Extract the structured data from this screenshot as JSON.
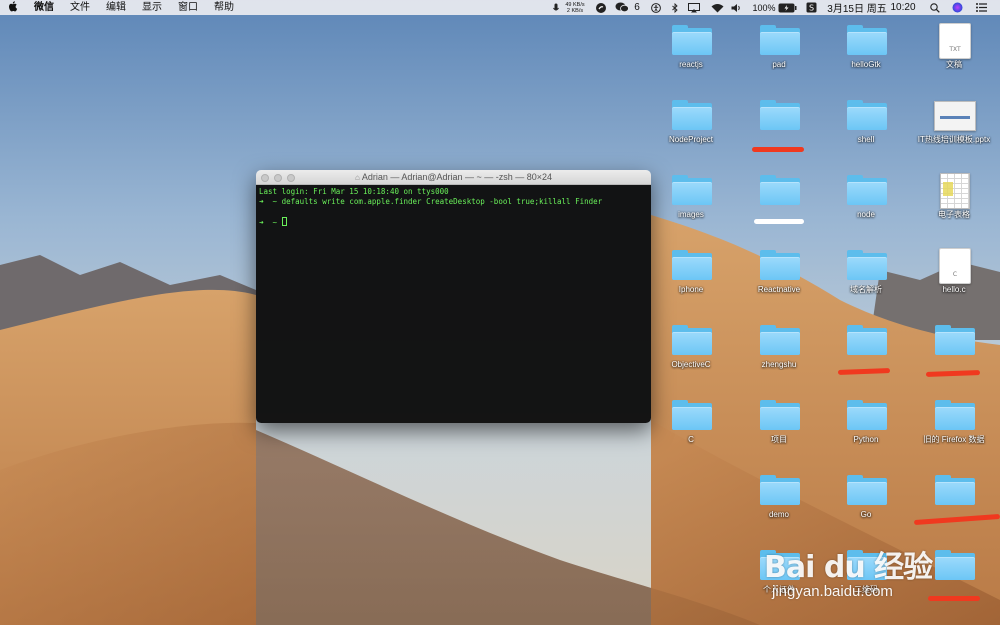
{
  "colors": {
    "accent_folder": "#6cc6f5",
    "terminal_green": "#6af05a",
    "scribble_red": "#f0391f"
  },
  "menubar": {
    "apple_icon": "apple-logo-icon",
    "app_name": "微信",
    "menus": [
      "文件",
      "编辑",
      "显示",
      "窗口",
      "帮助"
    ],
    "net_up": "49 KB/s",
    "net_down": "2 KB/s",
    "wechat_badge": "6",
    "battery": "100%",
    "date": "3月15日 周五",
    "time": "10:20"
  },
  "terminal": {
    "title": "Adrian — Adrian@Adrian — ~ — -zsh — 80×24",
    "lines": [
      "Last login: Fri Mar 15 10:18:40 on ttys000",
      "➜  ~ defaults write com.apple.finder CreateDesktop -bool true;killall Finder",
      "",
      "➜  ~ "
    ]
  },
  "desktop_icons": [
    {
      "label": "reactjs",
      "kind": "folder"
    },
    {
      "label": "pad",
      "kind": "folder"
    },
    {
      "label": "helloGtk",
      "kind": "folder"
    },
    {
      "label": "文稿",
      "kind": "txt",
      "ext": "TXT"
    },
    {
      "label": "NodeProject",
      "kind": "folder"
    },
    {
      "label": "",
      "kind": "folder"
    },
    {
      "label": "shell",
      "kind": "folder"
    },
    {
      "label": "IT热线培训模板.pptx",
      "kind": "pptx"
    },
    {
      "label": "images",
      "kind": "folder"
    },
    {
      "label": "",
      "kind": "folder"
    },
    {
      "label": "node",
      "kind": "folder"
    },
    {
      "label": "电子表格",
      "kind": "xls"
    },
    {
      "label": "Iphone",
      "kind": "folder"
    },
    {
      "label": "Reactnative",
      "kind": "folder"
    },
    {
      "label": "域名解析",
      "kind": "folder"
    },
    {
      "label": "hello.c",
      "kind": "c",
      "ext": "C"
    },
    {
      "label": "ObjectiveC",
      "kind": "folder"
    },
    {
      "label": "zhengshu",
      "kind": "folder"
    },
    {
      "label": "",
      "kind": "folder"
    },
    {
      "label": "",
      "kind": "folder"
    },
    {
      "label": "C",
      "kind": "folder"
    },
    {
      "label": "项目",
      "kind": "folder"
    },
    {
      "label": "Python",
      "kind": "folder"
    },
    {
      "label": "旧的 Firefox 数据",
      "kind": "folder"
    },
    {
      "label": "demo",
      "kind": "folder"
    },
    {
      "label": "Go",
      "kind": "folder"
    },
    {
      "label": "",
      "kind": "folder"
    },
    {
      "label": "个人证件",
      "kind": "folder"
    },
    {
      "label": "二维码",
      "kind": "folder"
    },
    {
      "label": "",
      "kind": "folder"
    }
  ],
  "watermark": {
    "logo": "Bai du 经验",
    "url": "jingyan.baidu.com"
  }
}
